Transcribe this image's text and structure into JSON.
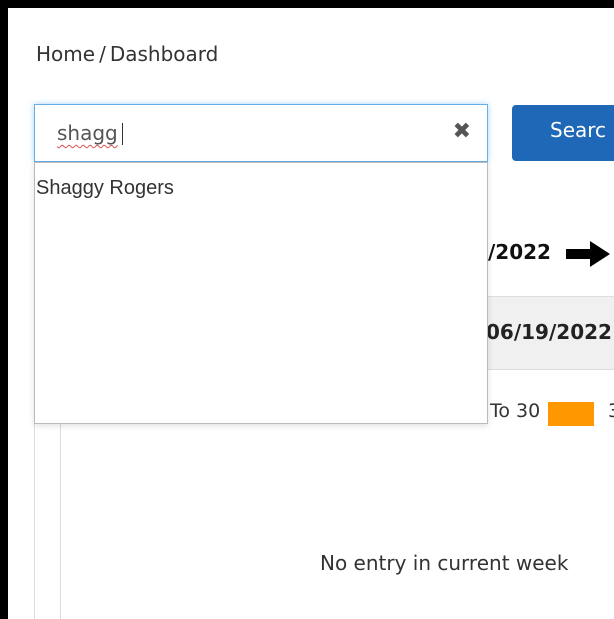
{
  "breadcrumb": {
    "home": "Home",
    "separator": "/",
    "current": "Dashboard"
  },
  "search": {
    "value": "shagg",
    "clear_icon": "close-icon",
    "button_label": "Searc"
  },
  "autocomplete": {
    "items": [
      {
        "label": "Shaggy Rogers"
      }
    ]
  },
  "week_nav": {
    "end_date_partial": "/2022",
    "next_icon": "arrow-right-icon"
  },
  "table": {
    "header_date_partial": "06/19/2022"
  },
  "legend": {
    "range_partial": "To 30",
    "more_partial": "3",
    "colors": {
      "green": "#2e9e2e",
      "orange": "#ff9800"
    }
  },
  "empty_state": "No entry in current week",
  "colors": {
    "accent": "#1f67b7",
    "focus": "#66afe9"
  }
}
